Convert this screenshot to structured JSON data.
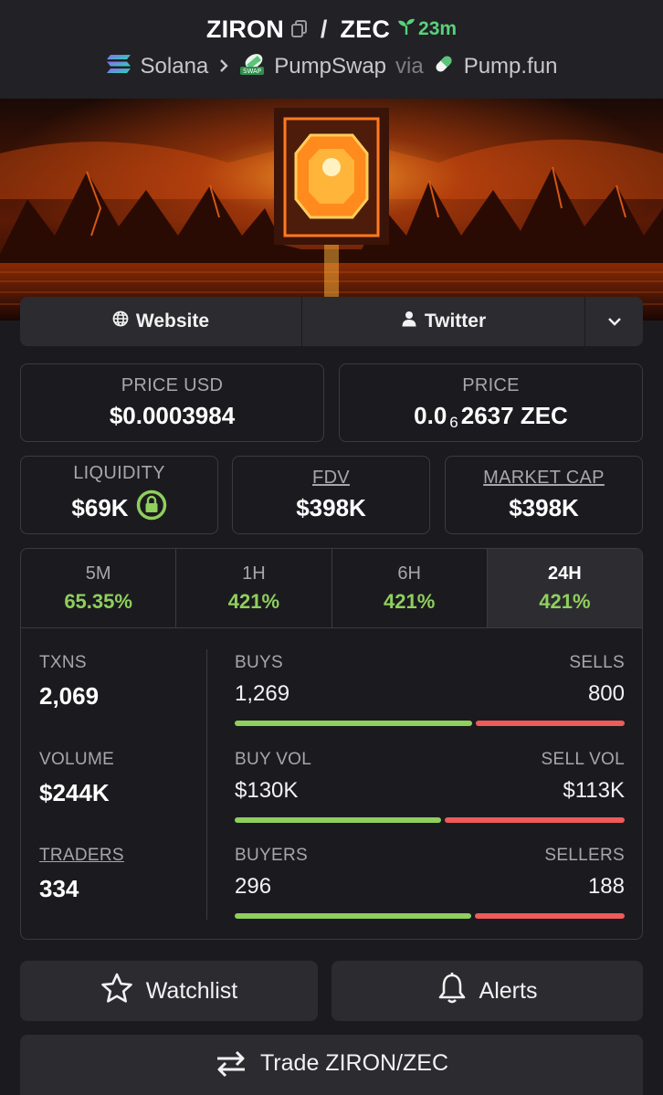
{
  "header": {
    "base_symbol": "ZIRON",
    "separator": "/",
    "quote_symbol": "ZEC",
    "age": "23m",
    "chain": "Solana",
    "dex": "PumpSwap",
    "via": "via",
    "launchpad": "Pump.fun"
  },
  "links": {
    "website": "Website",
    "twitter": "Twitter"
  },
  "price": {
    "usd_label": "PRICE USD",
    "usd_value": "$0.0003984",
    "native_label": "PRICE",
    "native_prefix": "0.0",
    "native_zeros": "6",
    "native_suffix": "2637 ZEC"
  },
  "metrics": {
    "liquidity_label": "LIQUIDITY",
    "liquidity_value": "$69K",
    "fdv_label": "FDV",
    "fdv_value": "$398K",
    "mcap_label": "MARKET CAP",
    "mcap_value": "$398K"
  },
  "tabs": [
    {
      "label": "5M",
      "value": "65.35%"
    },
    {
      "label": "1H",
      "value": "421%"
    },
    {
      "label": "6H",
      "value": "421%"
    },
    {
      "label": "24H",
      "value": "421%"
    }
  ],
  "active_tab": "24H",
  "stats": {
    "txns_label": "TXNS",
    "txns_value": "2,069",
    "volume_label": "VOLUME",
    "volume_value": "$244K",
    "traders_label": "TRADERS",
    "traders_value": "334",
    "buys_label": "BUYS",
    "buys_value": "1,269",
    "sells_label": "SELLS",
    "sells_value": "800",
    "buy_vol_label": "BUY VOL",
    "buy_vol_value": "$130K",
    "sell_vol_label": "SELL VOL",
    "sell_vol_value": "$113K",
    "buyers_label": "BUYERS",
    "buyers_value": "296",
    "sellers_label": "SELLERS",
    "sellers_value": "188"
  },
  "bars": {
    "buys_fraction": 0.613,
    "buy_vol_fraction": 0.535,
    "buyers_fraction": 0.612
  },
  "actions": {
    "watchlist": "Watchlist",
    "alerts": "Alerts",
    "trade": "Trade ZIRON/ZEC"
  },
  "colors": {
    "background": "#1b1b1f",
    "positive": "#8fcf5d",
    "negative": "#ef5a5a",
    "age_green": "#58d27a"
  },
  "icons": [
    "copy-icon",
    "seedling-icon",
    "solana-icon",
    "chevron-right-icon",
    "pumpswap-icon",
    "pill-icon",
    "globe-icon",
    "user-icon",
    "chevron-down-icon",
    "lock-icon",
    "star-icon",
    "bell-icon",
    "swap-icon"
  ]
}
